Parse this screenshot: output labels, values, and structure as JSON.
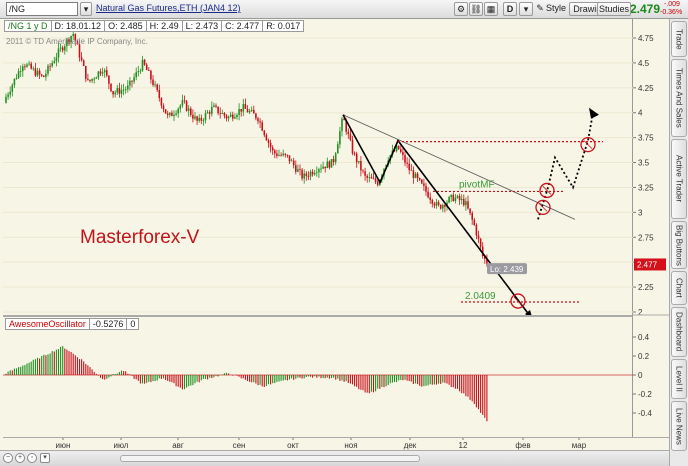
{
  "toolbar": {
    "symbol": "/NG",
    "title": "Natural Gas Futures,ETH (JAN4 12)",
    "period_button": "D",
    "style_label": "Style",
    "drawings_label": "Drawings",
    "studies_label": "Studies",
    "last_price": "2.479",
    "change": "-.009",
    "change_pct": "-0.36%"
  },
  "info": {
    "series": "/NG 1 y D",
    "date": "D: 18.01.12",
    "open": "O: 2.485",
    "high": "H: 2.49",
    "low": "L: 2.473",
    "close": "C: 2.477",
    "range": "R: 0.017"
  },
  "copyright": "2011 © TD Ameritrade IP Company, Inc.",
  "watermark": "Masterforex-V",
  "annotations": {
    "pivot_label": "pivotMF",
    "low_label": "Lo: 2.439",
    "target_label": "2.0409",
    "price_badge": "2.477"
  },
  "oscillator": {
    "name": "AwesomeOscillator",
    "value": "-0.5276",
    "extra": "0"
  },
  "price_axis": {
    "ticks": [
      "4.75",
      "4.5",
      "4.25",
      "4",
      "3.75",
      "3.5",
      "3.25",
      "3",
      "2.75",
      "2.5",
      "2.25",
      "2"
    ]
  },
  "osc_axis": {
    "ticks": [
      "0.4",
      "0.2",
      "0",
      "-0.2",
      "-0.4"
    ]
  },
  "time_axis": {
    "ticks": [
      "июн",
      "июл",
      "авг",
      "сен",
      "окт",
      "ноя",
      "дек",
      "12",
      "фев",
      "мар"
    ]
  },
  "side_tabs": [
    "Trade",
    "Times And Sales",
    "Active Trader",
    "Big Buttons",
    "Chart",
    "Dashboard",
    "Level II",
    "Live News"
  ],
  "colors": {
    "up": "#1f8f1f",
    "down": "#c8101a",
    "background": "#f7f5e6",
    "watermark": "#c0141c",
    "pivot": "#3a9a3a"
  }
}
